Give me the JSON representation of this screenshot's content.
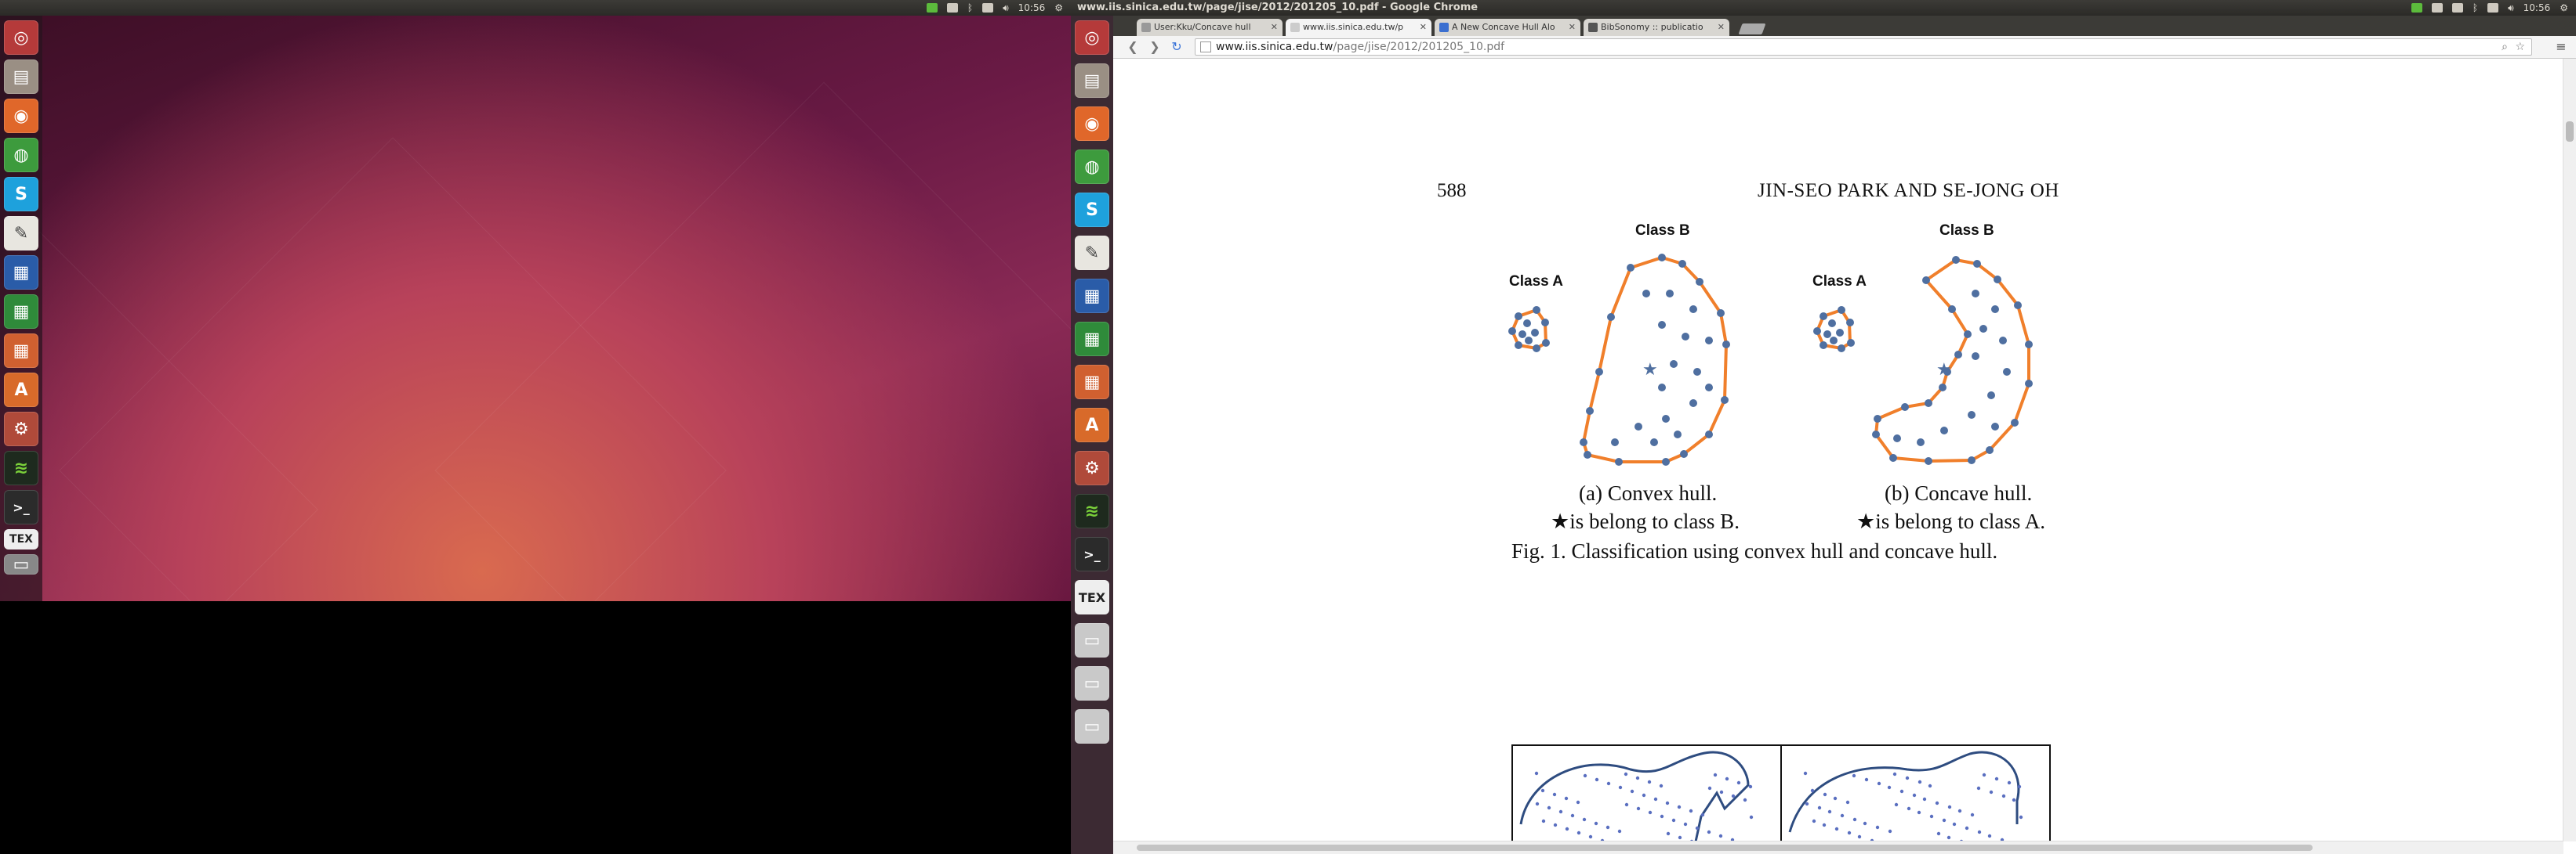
{
  "left_screen": {
    "topbar": {
      "time": "10:56"
    },
    "launcher_icons": [
      "ubuntu-dash-icon",
      "files-icon",
      "firefox-icon",
      "chrome-icon",
      "skype-icon",
      "text-editor-icon",
      "writer-icon",
      "calc-icon",
      "impress-icon",
      "software-center-icon",
      "system-settings-icon",
      "spotify-icon",
      "terminal-icon",
      "tex-icon",
      "workspace-icon"
    ]
  },
  "right_screen": {
    "topbar": {
      "window_title": "www.iis.sinica.edu.tw/page/jise/2012/201205_10.pdf - Google Chrome",
      "time": "10:56"
    },
    "launcher_icons": [
      "ubuntu-dash-icon",
      "files-icon",
      "firefox-icon",
      "chrome-icon",
      "skype-icon",
      "text-editor-icon",
      "writer-icon",
      "calc-icon",
      "impress-icon",
      "software-center-icon",
      "system-settings-icon",
      "spotify-icon",
      "terminal-icon",
      "tex-icon",
      "drive-icon",
      "drive-icon",
      "drive-icon"
    ],
    "launcher_labels": {
      "tex": "TEX",
      "terminal": ">_"
    }
  },
  "browser": {
    "tabs": [
      {
        "label": "User:Kku/Concave hull"
      },
      {
        "label": "www.iis.sinica.edu.tw/p"
      },
      {
        "label": "A New Concave Hull Alo"
      },
      {
        "label": "BibSonomy :: publicatio"
      }
    ],
    "address_host": "www.iis.sinica.edu.tw",
    "address_path": "/page/jise/2012/201205_10.pdf"
  },
  "pdf": {
    "page_number": "588",
    "running_head": "JIN-SEO PARK AND SE-JONG OH",
    "figure": {
      "class_a_label": "Class A",
      "class_b_label": "Class B",
      "caption_a_title": "(a) Convex hull.",
      "caption_a_note": "★is belong to class B.",
      "caption_b_title": "(b) Concave hull.",
      "caption_b_note": "★is belong to class A.",
      "figure_caption": "Fig. 1. Classification using convex hull and concave hull."
    },
    "colors": {
      "hull": "#f07f2b",
      "points": "#4f6fa0"
    }
  }
}
